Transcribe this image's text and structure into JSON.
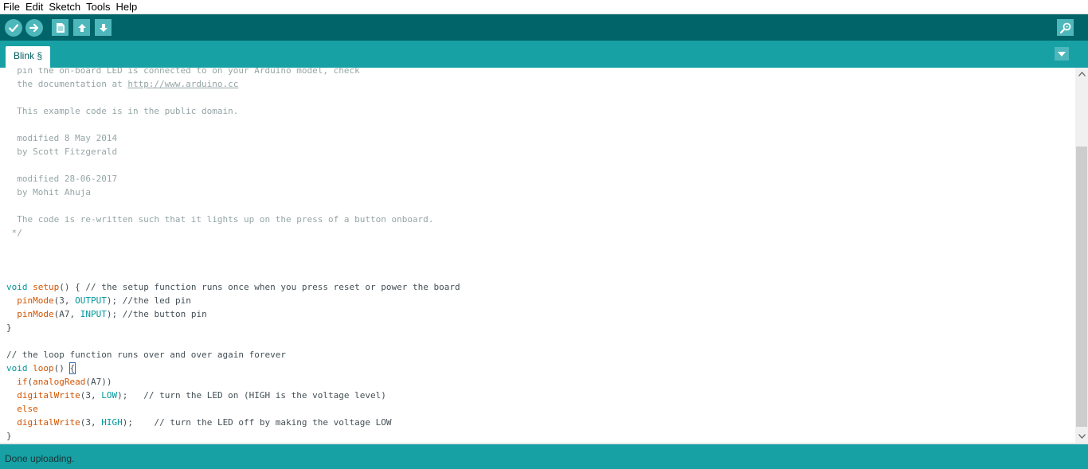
{
  "menu": {
    "items": [
      "File",
      "Edit",
      "Sketch",
      "Tools",
      "Help"
    ]
  },
  "toolbar": {
    "buttons": [
      {
        "name": "verify",
        "icon": "checkmark-icon"
      },
      {
        "name": "upload",
        "icon": "arrow-right-icon"
      },
      {
        "name": "new",
        "icon": "new-file-icon"
      },
      {
        "name": "open",
        "icon": "arrow-up-icon"
      },
      {
        "name": "save",
        "icon": "arrow-down-icon"
      },
      {
        "name": "serial-monitor",
        "icon": "magnifier-icon"
      }
    ]
  },
  "tabs": [
    {
      "label": "Blink §"
    }
  ],
  "editor": {
    "lines": [
      [
        {
          "t": "  pin the on-board LED is connected to on your Arduino model, check",
          "c": "comment"
        }
      ],
      [
        {
          "t": "  the documentation at ",
          "c": "comment"
        },
        {
          "t": "http://www.arduino.cc",
          "c": "link"
        }
      ],
      [
        {
          "t": "",
          "c": "comment"
        }
      ],
      [
        {
          "t": "  This example code is in the public domain.",
          "c": "comment"
        }
      ],
      [
        {
          "t": "",
          "c": "comment"
        }
      ],
      [
        {
          "t": "  modified 8 May 2014",
          "c": "comment"
        }
      ],
      [
        {
          "t": "  by Scott Fitzgerald",
          "c": "comment"
        }
      ],
      [
        {
          "t": "",
          "c": "comment"
        }
      ],
      [
        {
          "t": "  modified 28-06-2017",
          "c": "comment"
        }
      ],
      [
        {
          "t": "  by Mohit Ahuja",
          "c": "comment"
        }
      ],
      [
        {
          "t": "",
          "c": "comment"
        }
      ],
      [
        {
          "t": "  The code is re-written such that it lights up on the press of a button onboard.",
          "c": "comment"
        }
      ],
      [
        {
          "t": " */",
          "c": "comment"
        }
      ],
      [
        {
          "t": "",
          "c": "plain"
        }
      ],
      [
        {
          "t": "",
          "c": "plain"
        }
      ],
      [
        {
          "t": "",
          "c": "plain"
        }
      ],
      [
        {
          "t": "void",
          "c": "kw"
        },
        {
          "t": " ",
          "c": "plain"
        },
        {
          "t": "setup",
          "c": "fn"
        },
        {
          "t": "() { ",
          "c": "plain"
        },
        {
          "t": "// the setup function runs once when you press reset or power the board",
          "c": "plain"
        }
      ],
      [
        {
          "t": "  ",
          "c": "plain"
        },
        {
          "t": "pinMode",
          "c": "fn"
        },
        {
          "t": "(3, ",
          "c": "plain"
        },
        {
          "t": "OUTPUT",
          "c": "const"
        },
        {
          "t": "); //the led pin",
          "c": "plain"
        }
      ],
      [
        {
          "t": "  ",
          "c": "plain"
        },
        {
          "t": "pinMode",
          "c": "fn"
        },
        {
          "t": "(A7, ",
          "c": "plain"
        },
        {
          "t": "INPUT",
          "c": "const"
        },
        {
          "t": "); //the button pin",
          "c": "plain"
        }
      ],
      [
        {
          "t": "}",
          "c": "plain"
        }
      ],
      [
        {
          "t": "",
          "c": "plain"
        }
      ],
      [
        {
          "t": "// the loop function runs over and over again forever",
          "c": "plain"
        }
      ],
      [
        {
          "t": "void",
          "c": "kw"
        },
        {
          "t": " ",
          "c": "plain"
        },
        {
          "t": "loop",
          "c": "fn"
        },
        {
          "t": "() ",
          "c": "plain"
        },
        {
          "t": "{",
          "c": "bracket"
        }
      ],
      [
        {
          "t": "  ",
          "c": "plain"
        },
        {
          "t": "if",
          "c": "fn"
        },
        {
          "t": "(",
          "c": "plain"
        },
        {
          "t": "analogRead",
          "c": "fn"
        },
        {
          "t": "(A7))",
          "c": "plain"
        }
      ],
      [
        {
          "t": "  ",
          "c": "plain"
        },
        {
          "t": "digitalWrite",
          "c": "fn"
        },
        {
          "t": "(3, ",
          "c": "plain"
        },
        {
          "t": "LOW",
          "c": "const"
        },
        {
          "t": ");   // turn the LED on (HIGH is the voltage level)",
          "c": "plain"
        }
      ],
      [
        {
          "t": "  ",
          "c": "plain"
        },
        {
          "t": "else",
          "c": "fn"
        }
      ],
      [
        {
          "t": "  ",
          "c": "plain"
        },
        {
          "t": "digitalWrite",
          "c": "fn"
        },
        {
          "t": "(3, ",
          "c": "plain"
        },
        {
          "t": "HIGH",
          "c": "const"
        },
        {
          "t": ");    // turn the LED off by making the voltage LOW",
          "c": "plain"
        }
      ],
      [
        {
          "t": "}",
          "c": "plain"
        }
      ]
    ]
  },
  "status": {
    "message": "Done uploading."
  },
  "colors": {
    "toolbar": "#006468",
    "tabbar": "#17a1a5",
    "button": "#4db7bb",
    "comment": "#95a5a6",
    "keyword": "#00979c",
    "function": "#d35400"
  }
}
